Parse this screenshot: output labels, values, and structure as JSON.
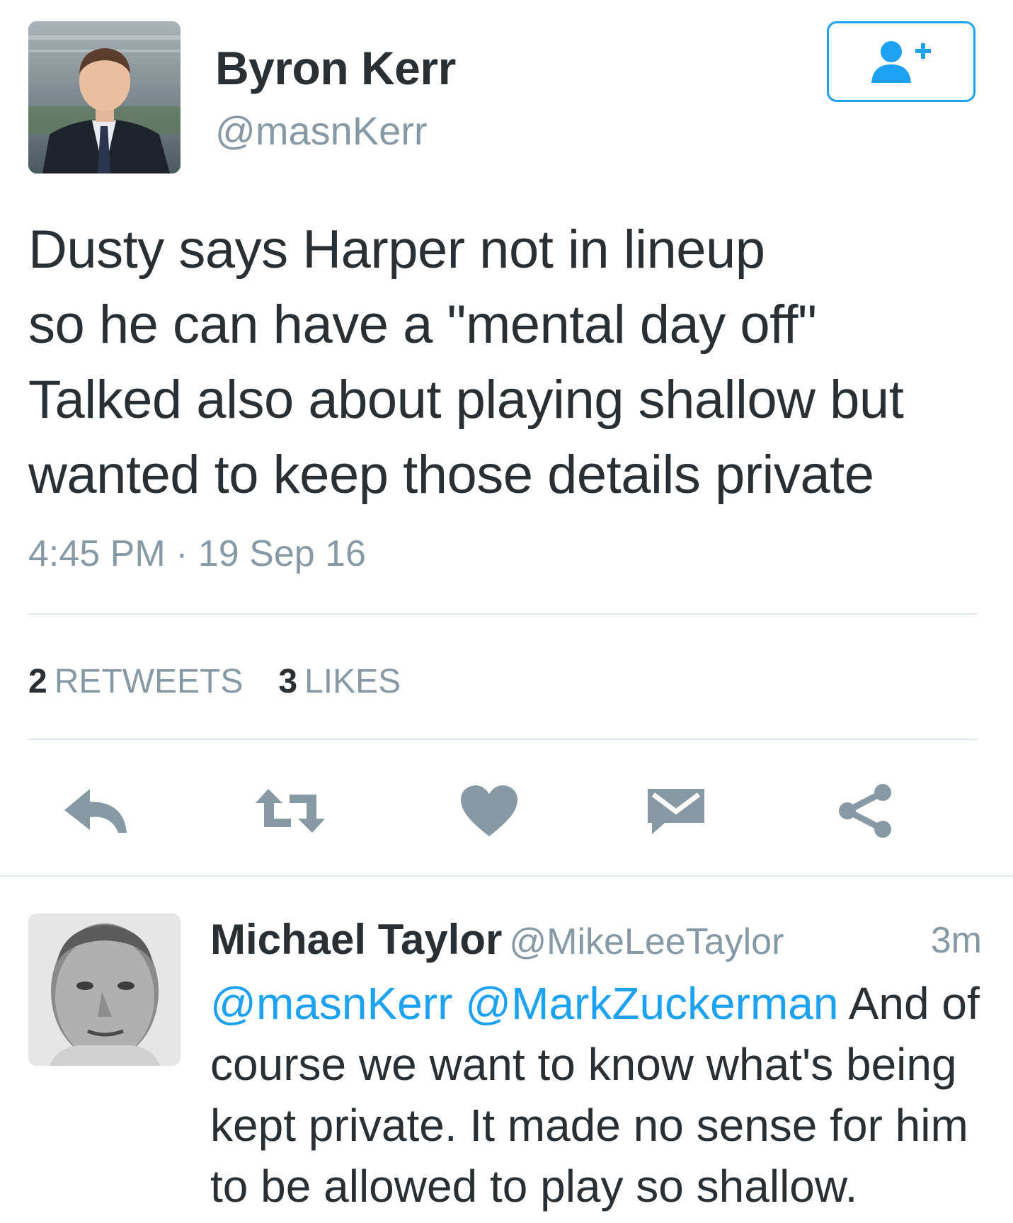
{
  "tweet": {
    "author_name": "Byron Kerr",
    "author_handle": "@masnKerr",
    "text": "Dusty says Harper not in lineup\nso he can have a \"mental day off\"\nTalked also about playing shallow but\nwanted to keep those details private",
    "timestamp": "4:45 PM · 19 Sep 16",
    "retweets_count": "2",
    "retweets_label": "RETWEETS",
    "likes_count": "3",
    "likes_label": "LIKES"
  },
  "actions": [
    {
      "name": "reply-icon"
    },
    {
      "name": "retweet-icon"
    },
    {
      "name": "heart-icon"
    },
    {
      "name": "message-icon"
    },
    {
      "name": "share-icon"
    }
  ],
  "reply": {
    "author_name": "Michael Taylor",
    "author_handle": "@MikeLeeTaylor",
    "time": "3m",
    "mention_1": "@masnKerr",
    "mention_2": "@MarkZuckerman",
    "text": " And of course we want to know what's being kept private. It made no sense for him to be allowed to play so shallow."
  },
  "colors": {
    "accent": "#1da1f2",
    "icon_gray": "#8899a6",
    "text": "#292f33"
  }
}
